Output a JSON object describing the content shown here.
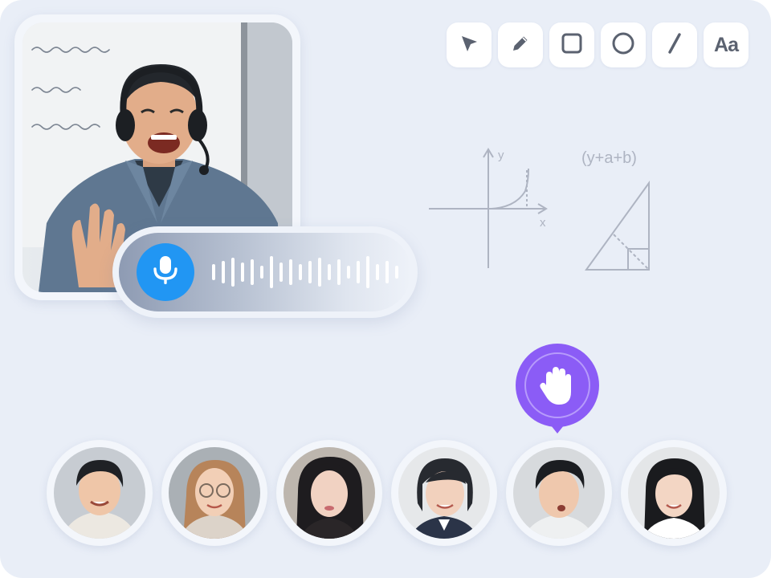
{
  "toolbar": {
    "tools": [
      {
        "name": "select",
        "icon": "cursor-arrow-icon"
      },
      {
        "name": "pen",
        "icon": "pencil-icon"
      },
      {
        "name": "rectangle",
        "icon": "square-icon"
      },
      {
        "name": "circle",
        "icon": "circle-icon"
      },
      {
        "name": "line",
        "icon": "line-icon"
      },
      {
        "name": "text",
        "label": "Aa"
      }
    ]
  },
  "whiteboard": {
    "graph": {
      "x_label": "x",
      "y_label": "y"
    },
    "formula": "(y+a+b)"
  },
  "voice": {
    "icon": "microphone-icon",
    "state": "speaking"
  },
  "raise_hand": {
    "icon": "raised-hand-icon",
    "active_student_index": 4
  },
  "students": {
    "count": 6
  },
  "colors": {
    "background": "#e9eef7",
    "mic_blue": "#2196f3",
    "raise_hand_purple": "#8b5cf6",
    "tool_icon": "#5b6270",
    "sketch": "#aeb4c2"
  }
}
